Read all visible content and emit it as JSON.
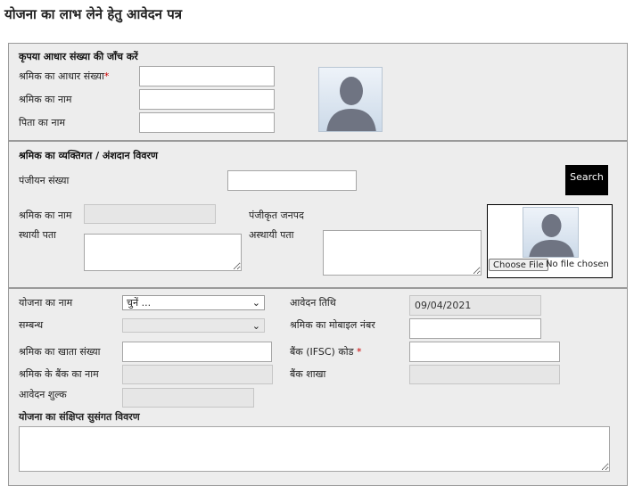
{
  "page_title": "योजना का लाभ लेने हेतु आवेदन पत्र",
  "aadhaar_section": {
    "title": "कृपया आधार संख्या की जाँच करें",
    "aadhaar_label": "श्रमिक का आधार संख्या",
    "required_mark": "*",
    "worker_name_label": "श्रमिक का नाम",
    "father_name_label": "पिता का नाम",
    "aadhaar_value": "",
    "worker_name_value": "",
    "father_name_value": ""
  },
  "personal_section": {
    "title": "श्रमिक का व्यक्तिगत / अंशदान विवरण",
    "registration_label": "पंजीयन संख्या",
    "registration_value": "",
    "search_label": "Search",
    "worker_name_label": "श्रमिक का नाम",
    "registered_district_label": "पंजीकृत जनपद",
    "permanent_address_label": "स्थायी पता",
    "temporary_address_label": "अस्थायी पता",
    "choose_file_label": "Choose File",
    "no_file_text": "No file chosen"
  },
  "scheme_section": {
    "scheme_name_label": "योजना का नाम",
    "scheme_select_value": "चुनें ...",
    "application_date_label": "आवेदन तिथि",
    "application_date_value": "09/04/2021",
    "relation_label": "सम्बन्ध",
    "relation_value": "",
    "mobile_label": "श्रमिक का मोबाइल नंबर",
    "mobile_value": "",
    "account_label": "श्रमिक का खाता संख्या",
    "account_value": "",
    "ifsc_label": "बैंक (IFSC) कोड",
    "ifsc_required": "*",
    "ifsc_value": "",
    "bank_name_label": "श्रमिक के बैंक का नाम",
    "branch_label": "बैंक शाखा",
    "fee_label": "आवेदन शुल्क",
    "description_label": "योजना का संक्षिप्त सुसंगत विवरण",
    "description_value": ""
  }
}
